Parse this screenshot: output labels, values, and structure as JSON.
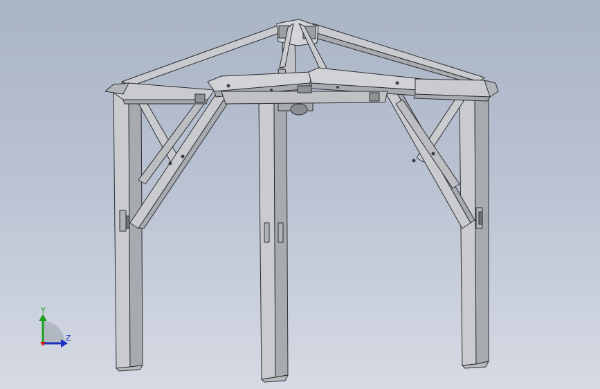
{
  "viewport": {
    "background_top": "#a9b4c5",
    "background_bottom": "#d6dae4"
  },
  "model": {
    "object": "gazebo-frame",
    "face_color": "#c9cbce",
    "shade_color": "#a7aaae",
    "edge_color": "#2b2d30",
    "detail_color": "#6f7378"
  },
  "triad": {
    "y_label": "Y",
    "z_label": "Z",
    "y_color": "#18a018",
    "z_color": "#1a2fc0",
    "x_color": "#d01818"
  }
}
